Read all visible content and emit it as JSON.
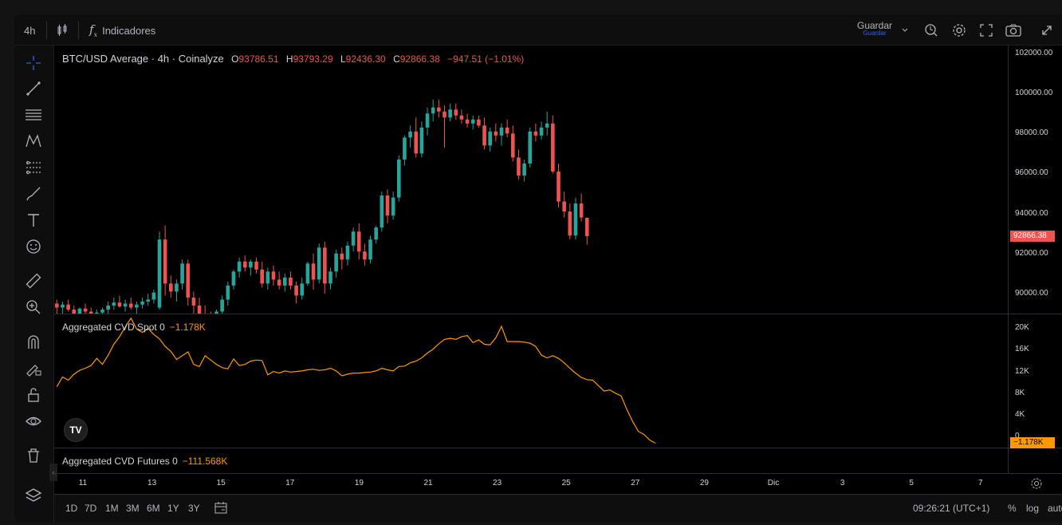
{
  "topbar": {
    "interval": "4h",
    "indicators_label": "Indicadores",
    "save_label": "Guardar",
    "save_sub_label": "Guardar"
  },
  "main_legend": {
    "title": "BTC/USD Average · 4h · Coinalyze",
    "open_key": "O",
    "open": "93786.51",
    "high_key": "H",
    "high": "93793.29",
    "low_key": "L",
    "low": "92436.30",
    "close_key": "C",
    "close": "92866.38",
    "change": "−947.51 (−1.01%)"
  },
  "cvd_spot_legend": {
    "name": "Aggregated CVD Spot 0",
    "value": "−1.178K"
  },
  "cvd_futures_legend": {
    "name": "Aggregated CVD Futures 0",
    "value": "−111.568K"
  },
  "price_axis": {
    "ticks": [
      "102000.00",
      "100000.00",
      "98000.00",
      "96000.00",
      "94000.00",
      "92000.00",
      "90000.00"
    ],
    "current": "92866.38"
  },
  "cvd_axis": {
    "ticks": [
      "20K",
      "16K",
      "12K",
      "8K",
      "4K",
      "0"
    ],
    "current": "−1.178K"
  },
  "time_axis": {
    "ticks": [
      "11",
      "13",
      "15",
      "17",
      "19",
      "21",
      "23",
      "25",
      "27",
      "29",
      "Dic",
      "3",
      "5",
      "7"
    ]
  },
  "bottombar": {
    "ranges": [
      "1D",
      "7D",
      "1M",
      "3M",
      "6M",
      "1Y",
      "3Y"
    ],
    "clock": "09:26:21 (UTC+1)",
    "percent": "%",
    "log": "log",
    "auto": "auto"
  },
  "logo_text": "TV",
  "colors": {
    "up": "#26a69a",
    "down": "#ef5350",
    "cvd": "#ff9800"
  },
  "chart_data": {
    "type": "candlestick",
    "price_range": [
      89000,
      102400
    ],
    "candles": [
      [
        89500,
        89700,
        88900,
        89300
      ],
      [
        89300,
        89600,
        89000,
        89450
      ],
      [
        89450,
        89700,
        89100,
        89200
      ],
      [
        89200,
        89400,
        88900,
        89000
      ],
      [
        89000,
        89300,
        88800,
        89250
      ],
      [
        89250,
        89500,
        89000,
        89100
      ],
      [
        89100,
        89300,
        88800,
        88900
      ],
      [
        88900,
        89200,
        88700,
        89050
      ],
      [
        89050,
        89300,
        88900,
        89200
      ],
      [
        89200,
        89600,
        88950,
        89400
      ],
      [
        89400,
        89800,
        89200,
        89550
      ],
      [
        89550,
        89900,
        89300,
        89350
      ],
      [
        89350,
        89700,
        89100,
        89500
      ],
      [
        89500,
        89800,
        89200,
        89300
      ],
      [
        89300,
        89600,
        89000,
        89450
      ],
      [
        89450,
        89800,
        89250,
        89600
      ],
      [
        89600,
        90000,
        89400,
        89700
      ],
      [
        89700,
        90200,
        89500,
        90050
      ],
      [
        89300,
        93100,
        89200,
        92700
      ],
      [
        92700,
        93400,
        89900,
        90500
      ],
      [
        90500,
        90900,
        89800,
        90100
      ],
      [
        90100,
        90700,
        89600,
        90500
      ],
      [
        90500,
        91700,
        90200,
        91500
      ],
      [
        91500,
        91700,
        89400,
        89800
      ],
      [
        89800,
        90100,
        89000,
        89400
      ],
      [
        89400,
        89800,
        88700,
        89000
      ],
      [
        89000,
        89400,
        88500,
        88800
      ],
      [
        88800,
        89100,
        88400,
        88700
      ],
      [
        88700,
        89200,
        88500,
        89100
      ],
      [
        89100,
        89900,
        88900,
        89700
      ],
      [
        89700,
        90600,
        89400,
        90400
      ],
      [
        90400,
        91200,
        90200,
        91100
      ],
      [
        91100,
        91800,
        90800,
        91600
      ],
      [
        91600,
        91900,
        91100,
        91300
      ],
      [
        91300,
        91700,
        90900,
        91600
      ],
      [
        91600,
        91800,
        91000,
        91200
      ],
      [
        91200,
        91600,
        90300,
        90500
      ],
      [
        90500,
        91300,
        90200,
        91100
      ],
      [
        91100,
        91400,
        90400,
        90700
      ],
      [
        90700,
        91100,
        90200,
        90400
      ],
      [
        90400,
        91000,
        90100,
        90800
      ],
      [
        90800,
        91100,
        90200,
        90400
      ],
      [
        90400,
        90600,
        89500,
        89900
      ],
      [
        89900,
        90800,
        89700,
        90500
      ],
      [
        90500,
        91600,
        90400,
        91500
      ],
      [
        91500,
        92000,
        90200,
        90700
      ],
      [
        90700,
        92500,
        90500,
        92300
      ],
      [
        92300,
        92600,
        90000,
        90500
      ],
      [
        90500,
        91300,
        90200,
        91100
      ],
      [
        91100,
        92200,
        90800,
        92000
      ],
      [
        92000,
        92300,
        91200,
        91700
      ],
      [
        91700,
        92600,
        91400,
        92400
      ],
      [
        92400,
        93300,
        92100,
        93100
      ],
      [
        93100,
        93500,
        91700,
        92100
      ],
      [
        92100,
        92500,
        91400,
        91700
      ],
      [
        91700,
        92900,
        91500,
        92700
      ],
      [
        92700,
        93400,
        92500,
        93300
      ],
      [
        93300,
        95100,
        93100,
        94900
      ],
      [
        94900,
        95200,
        93500,
        93900
      ],
      [
        93900,
        95100,
        93700,
        94800
      ],
      [
        94800,
        96900,
        94600,
        96700
      ],
      [
        96700,
        97900,
        96400,
        97800
      ],
      [
        97800,
        98400,
        97300,
        98100
      ],
      [
        98100,
        98800,
        96800,
        97000
      ],
      [
        97000,
        98600,
        96800,
        98300
      ],
      [
        98300,
        99300,
        97900,
        99000
      ],
      [
        99000,
        99700,
        98600,
        99300
      ],
      [
        99300,
        99700,
        98800,
        99100
      ],
      [
        99100,
        99400,
        97300,
        98800
      ],
      [
        98800,
        99500,
        98600,
        99200
      ],
      [
        99200,
        99500,
        98700,
        98900
      ],
      [
        98900,
        99200,
        98500,
        98700
      ],
      [
        98700,
        99000,
        98300,
        98500
      ],
      [
        98500,
        98900,
        98200,
        98700
      ],
      [
        98700,
        98900,
        98300,
        98400
      ],
      [
        98400,
        98800,
        97200,
        97400
      ],
      [
        97400,
        98300,
        97100,
        98100
      ],
      [
        98100,
        98500,
        97600,
        97900
      ],
      [
        97900,
        98500,
        97400,
        98300
      ],
      [
        98300,
        98700,
        97800,
        98000
      ],
      [
        98000,
        98400,
        96600,
        96800
      ],
      [
        96800,
        97200,
        95700,
        95900
      ],
      [
        95900,
        96700,
        95600,
        96500
      ],
      [
        96500,
        98300,
        96300,
        98100
      ],
      [
        98100,
        98500,
        97600,
        97900
      ],
      [
        97900,
        98600,
        97700,
        98300
      ],
      [
        98300,
        99100,
        97900,
        98500
      ],
      [
        98500,
        98900,
        96000,
        96100
      ],
      [
        96100,
        96500,
        94300,
        94600
      ],
      [
        94600,
        95100,
        93800,
        94100
      ],
      [
        94100,
        94500,
        92700,
        92900
      ],
      [
        92900,
        94800,
        92700,
        94500
      ],
      [
        94500,
        95000,
        93600,
        93800
      ],
      [
        93786.51,
        93793.29,
        92436.3,
        92866.38
      ]
    ],
    "cvd_spot_range": [
      -2000,
      22500
    ],
    "cvd_spot": [
      9200,
      11000,
      10400,
      11500,
      12200,
      12600,
      13100,
      14400,
      13300,
      15000,
      17000,
      18400,
      20200,
      21800,
      19800,
      19200,
      19900,
      18800,
      18000,
      16600,
      15700,
      14200,
      14900,
      15600,
      13300,
      12900,
      14900,
      14100,
      13300,
      12700,
      12500,
      14300,
      13100,
      13300,
      13900,
      14100,
      14000,
      11400,
      12000,
      11700,
      12100,
      11900,
      12000,
      12100,
      12300,
      12400,
      12200,
      12300,
      12600,
      12100,
      11200,
      11500,
      11700,
      11700,
      11800,
      11900,
      12100,
      12600,
      12300,
      12100,
      12900,
      13000,
      13600,
      13900,
      14500,
      15400,
      16100,
      17100,
      17900,
      18100,
      17900,
      18400,
      18600,
      17300,
      17800,
      17000,
      16900,
      18200,
      20300,
      17500,
      17500,
      17500,
      17400,
      17200,
      16600,
      15000,
      14500,
      14900,
      14400,
      13600,
      12600,
      11700,
      10900,
      10500,
      10400,
      9400,
      8400,
      8600,
      8000,
      7500,
      5000,
      2800,
      1000,
      400,
      -600,
      -1178
    ]
  }
}
